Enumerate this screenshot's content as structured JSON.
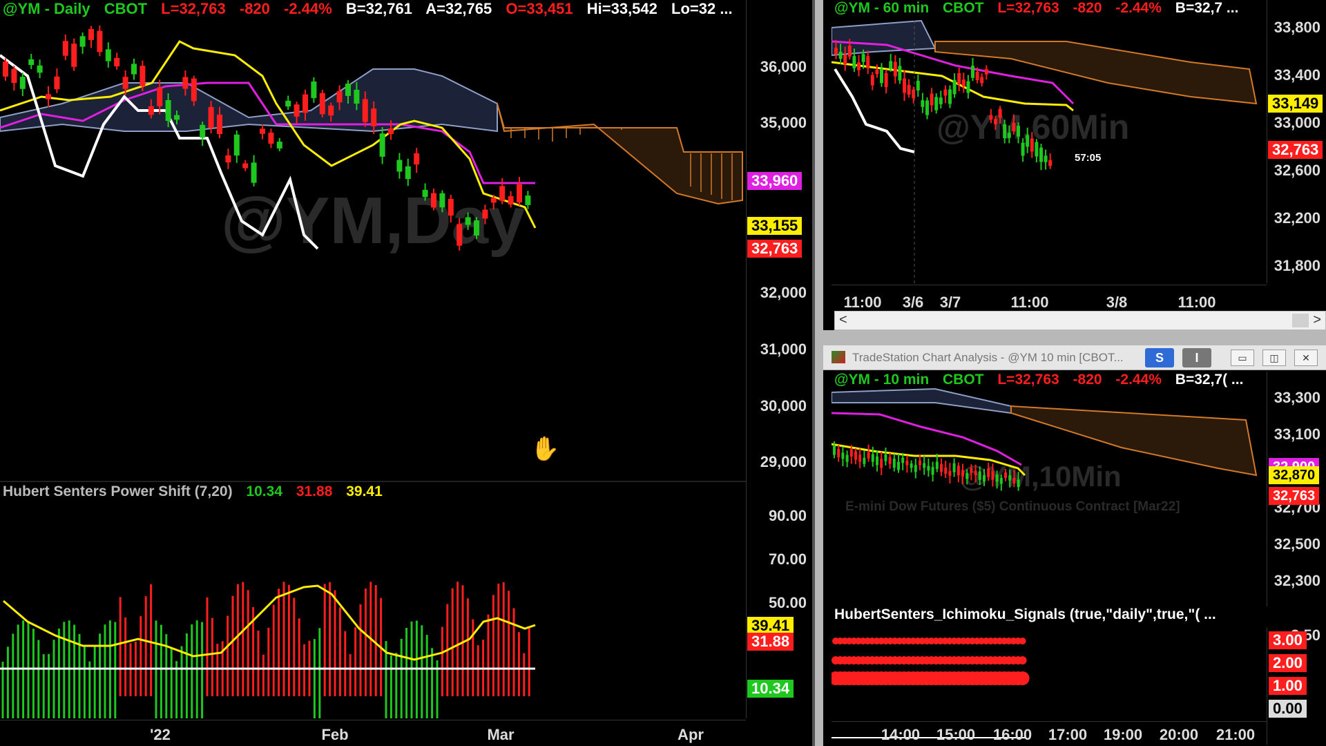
{
  "daily": {
    "header": {
      "symbol": "@YM - Daily",
      "exchange": "CBOT",
      "last": "L=32,763",
      "change": "-820",
      "pct": "-2.44%",
      "bid": "B=32,761",
      "ask": "A=32,765",
      "open": "O=33,451",
      "high": "Hi=33,542",
      "low": "Lo=32 ..."
    },
    "watermark": "@YM,Day",
    "price_ticks": [
      "36,000",
      "35,000",
      "33,960",
      "33,155",
      "32,763",
      "32,000",
      "31,000",
      "30,000",
      "29,000"
    ],
    "tags": {
      "magenta": "33,960",
      "yellow": "33,155",
      "red": "32,763"
    },
    "indicator": {
      "title": "Hubert Senters Power Shift (7,20)",
      "v1": "10.34",
      "v2": "31.88",
      "v3": "39.41",
      "ticks": [
        "90.00",
        "70.00",
        "50.00"
      ],
      "tags": {
        "yellow": "39.41",
        "red": "31.88",
        "green": "10.34"
      }
    },
    "x_labels": [
      "'22",
      "Feb",
      "Mar",
      "Apr"
    ]
  },
  "h60": {
    "header": {
      "symbol": "@YM - 60 min",
      "exchange": "CBOT",
      "last": "L=32,763",
      "change": "-820",
      "pct": "-2.44%",
      "bid": "B=32,7 ..."
    },
    "watermark": "@YM,60Min",
    "countdown": "57:05",
    "price_ticks": [
      "33,800",
      "33,400",
      "33,000",
      "32,600",
      "32,200",
      "31,800"
    ],
    "tags": {
      "yellow": "33,149",
      "red": "32,763"
    },
    "x_labels": [
      "11:00",
      "3/6",
      "3/7",
      "11:00",
      "3/8",
      "11:00"
    ],
    "scroll_left": "<",
    "scroll_right": ">"
  },
  "m10": {
    "window_title": "TradeStation Chart Analysis - @YM 10 min [CBOT...",
    "btn_s": "S",
    "btn_i": "I",
    "header": {
      "symbol": "@YM - 10 min",
      "exchange": "CBOT",
      "last": "L=32,763",
      "change": "-820",
      "pct": "-2.44%",
      "bid": "B=32,7( ..."
    },
    "watermark": "@YM,10Min",
    "description": "E-mini Dow Futures ($5) Continuous Contract [Mar22]",
    "price_ticks": [
      "33,300",
      "33,100",
      "32,900",
      "32,700",
      "32,500",
      "32,300"
    ],
    "tags": {
      "magenta": "32,900",
      "yellow": "32,870",
      "red": "32,763"
    },
    "indicator": {
      "title": "HubertSenters_Ichimoku_Signals (true,\"daily\",true,\"( ...",
      "ticks": [
        "3.50",
        "3.00",
        "2.00",
        "1.00",
        "0.00"
      ]
    },
    "x_labels": [
      "14:00",
      "15:00",
      "16:00",
      "17:00",
      "19:00",
      "20:00",
      "21:00"
    ]
  },
  "colors": {
    "up": "#1ec81e",
    "down": "#ff1e1e",
    "magenta": "#e020e0",
    "yellow": "#ffee00",
    "cloud_bear": "#d27a28",
    "cloud_bull": "#8fa0c8"
  }
}
